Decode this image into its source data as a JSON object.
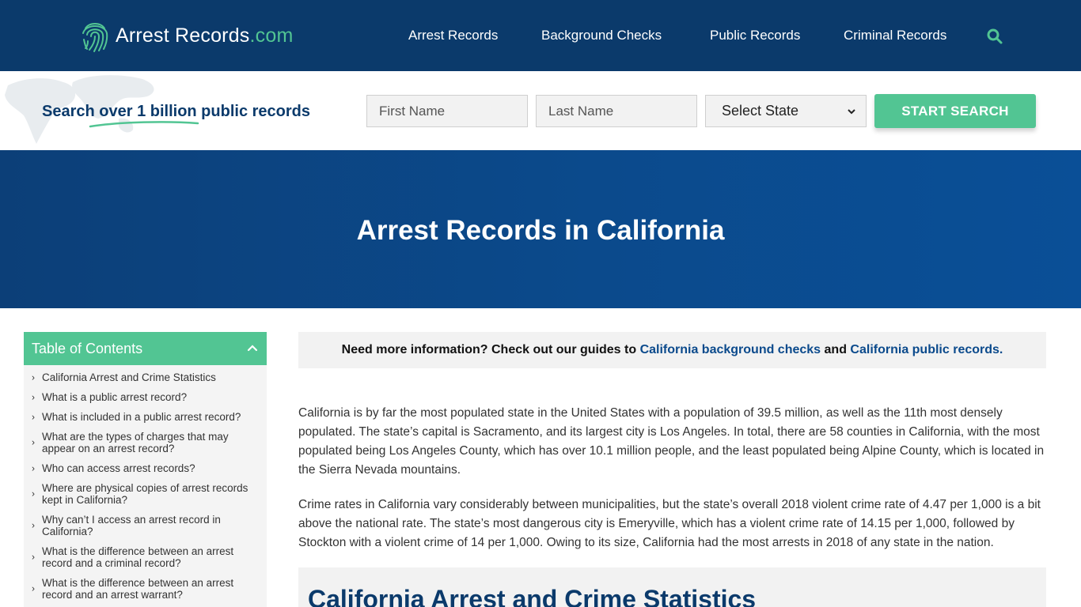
{
  "header": {
    "logo": {
      "main": "Arrest Records",
      "suffix": ".com"
    },
    "nav": [
      {
        "label": "Arrest Records"
      },
      {
        "label": "Background Checks"
      },
      {
        "label": "Public Records"
      },
      {
        "label": "Criminal Records"
      }
    ]
  },
  "search": {
    "tagline": "Search over 1 billion public records",
    "first_name_placeholder": "First Name",
    "last_name_placeholder": "Last Name",
    "state_selected": "Select State",
    "submit_label": "START SEARCH"
  },
  "hero": {
    "title": "Arrest Records in California"
  },
  "toc": {
    "title": "Table of Contents",
    "items": [
      "California Arrest and Crime Statistics",
      "What is a public arrest record?",
      "What is included in a public arrest record?",
      "What are the types of charges that may appear on an arrest record?",
      "Who can access arrest records?",
      "Where are physical copies of arrest records kept in California?",
      "Why can’t I access an arrest record in California?",
      "What is the difference between an arrest record and a criminal record?",
      "What is the difference between an arrest record and an arrest warrant?"
    ]
  },
  "notice": {
    "prefix": "Need more information? Check out our guides to ",
    "link1": "California background checks",
    "middle": " and ",
    "link2": "California public records."
  },
  "content": {
    "p1": "California is by far the most populated state in the United States with a population of 39.5 million, as well as the 11th most densely populated. The state’s capital is Sacramento, and its largest city is Los Angeles. In total, there are 58 counties in California, with the most populated being Los Angeles County, which has over 10.1 million people, and the least populated being Alpine County, which is located in the Sierra Nevada mountains.",
    "p2": "Crime rates in California vary considerably between municipalities, but the state’s overall 2018 violent crime rate of 4.47 per 1,000 is a bit above the national rate. The state’s most dangerous city is Emeryville, which has a violent crime rate of 14.15 per 1,000, followed by Stockton with a violent crime of 14 per 1,000. Owing to its size, California had the most arrests in 2018 of any state in the nation.",
    "section_heading": "California Arrest and Crime Statistics"
  },
  "colors": {
    "navy": "#0b3a6b",
    "accent_green": "#52c593",
    "hero_blue": "#0b4a8c",
    "panel_gray": "#f2f2f2"
  },
  "icons": [
    "fingerprint-icon",
    "search-icon",
    "chevron-up-icon",
    "chevron-right-icon",
    "chevron-down-icon"
  ]
}
